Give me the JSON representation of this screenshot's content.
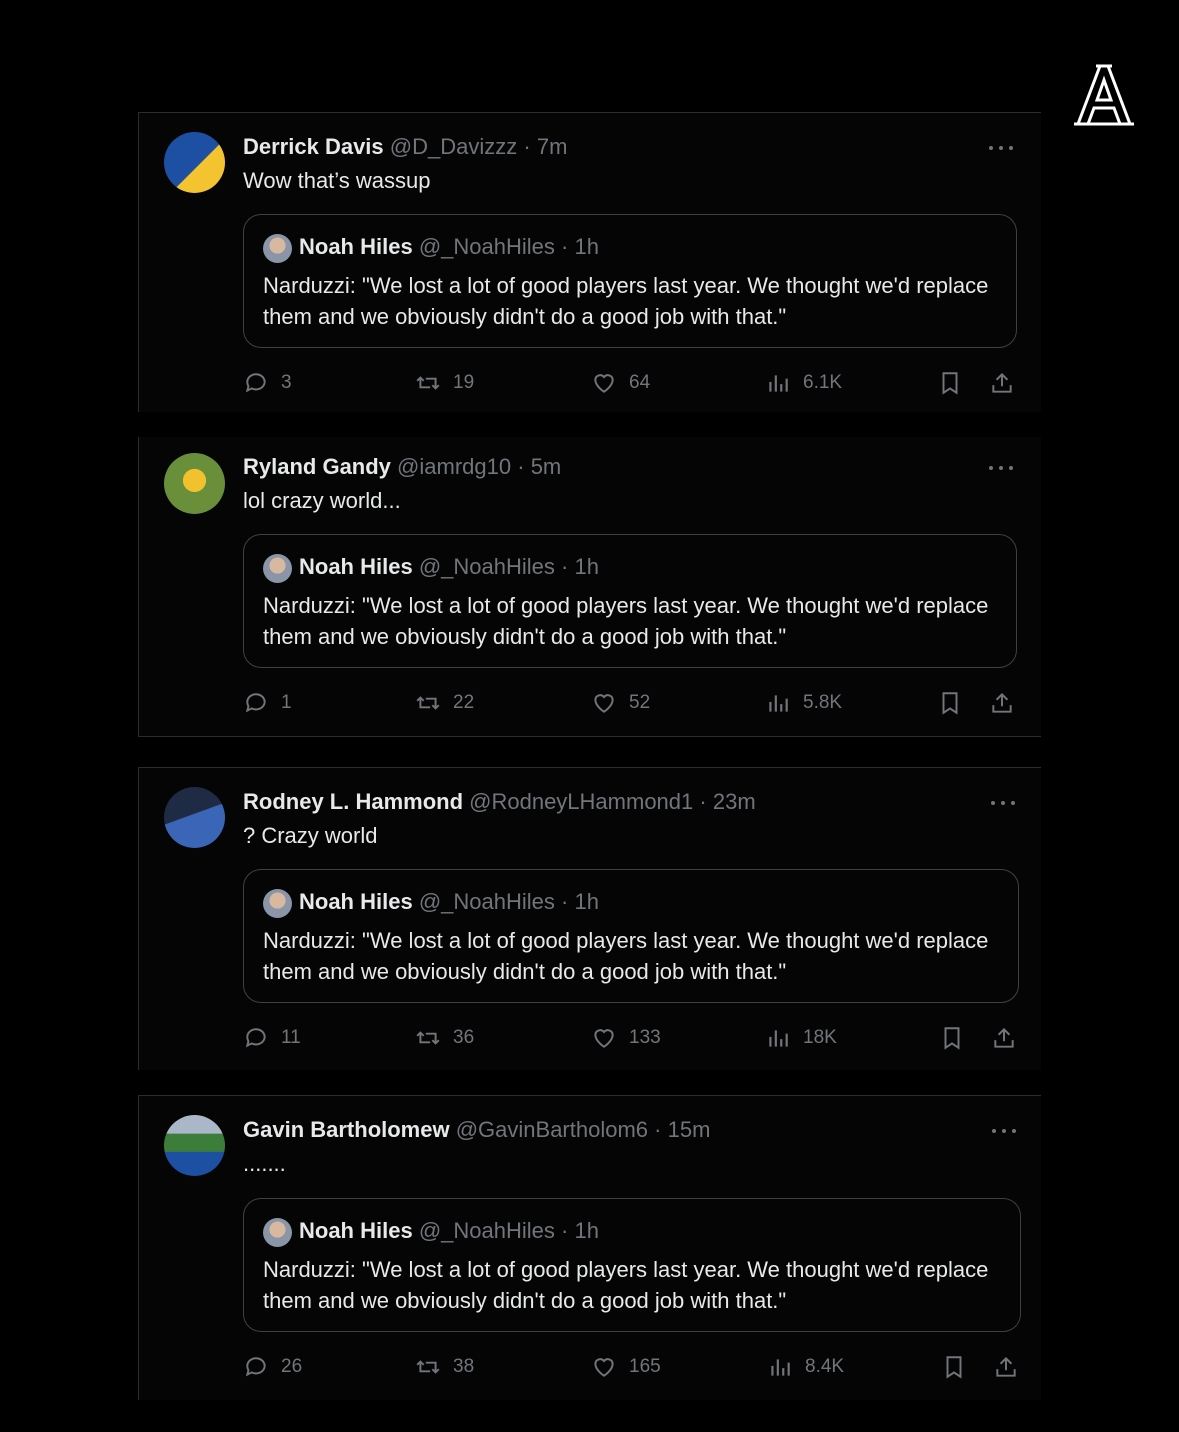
{
  "brand": {
    "logo_letter": "A"
  },
  "quoted": {
    "name": "Noah Hiles",
    "handle": "@_NoahHiles",
    "time": "1h",
    "text": "Narduzzi: \"We lost a lot of good players last year. We thought we'd replace them and we obviously didn't do a good job with that.\""
  },
  "tweets": [
    {
      "name": "Derrick Davis",
      "handle": "@D_Davizzz",
      "time": "7m",
      "text": "Wow that’s wassup",
      "replies": "3",
      "retweets": "19",
      "likes": "64",
      "views": "6.1K",
      "avatar_colors": [
        "#1d4fa3",
        "#f4c430"
      ]
    },
    {
      "name": "Ryland Gandy",
      "handle": "@iamrdg10",
      "time": "5m",
      "text": "lol crazy world...",
      "replies": "1",
      "retweets": "22",
      "likes": "52",
      "views": "5.8K",
      "avatar_colors": [
        "#6a8f3a",
        "#f2c12e"
      ]
    },
    {
      "name": "Rodney L. Hammond",
      "handle": "@RodneyLHammond1",
      "time": "23m",
      "text": "? Crazy world",
      "replies": "11",
      "retweets": "36",
      "likes": "133",
      "views": "18K",
      "avatar_colors": [
        "#1f2b45",
        "#3b66b8"
      ]
    },
    {
      "name": "Gavin Bartholomew",
      "handle": "@GavinBartholom6",
      "time": "15m",
      "text": ".......",
      "replies": "26",
      "retweets": "38",
      "likes": "165",
      "views": "8.4K",
      "avatar_colors": [
        "#3c7d3a",
        "#1d4fa3"
      ]
    }
  ],
  "separator": "·"
}
